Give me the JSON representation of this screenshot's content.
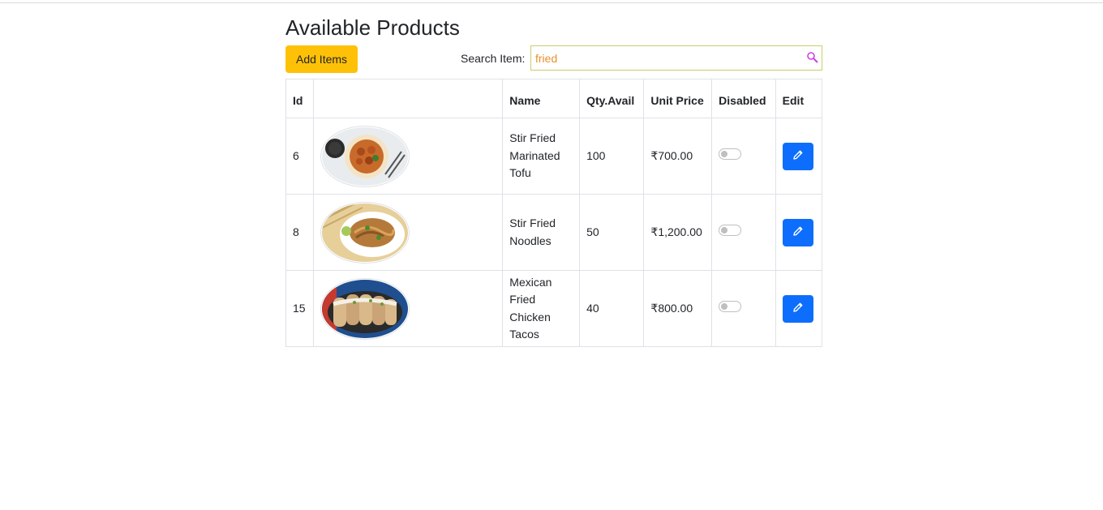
{
  "page": {
    "title": "Available Products"
  },
  "toolbar": {
    "add_label": "Add Items",
    "search_label": "Search Item:",
    "search_value": "fried"
  },
  "table": {
    "headers": {
      "id": "Id",
      "image": "",
      "name": "Name",
      "qty": "Qty.Avail",
      "price": "Unit Price",
      "disabled": "Disabled",
      "edit": "Edit"
    },
    "rows": [
      {
        "id": "6",
        "name": "Stir Fried Marinated Tofu",
        "qty": "100",
        "price": "₹700.00",
        "disabled": false,
        "image_icon": "tofu-bowl-image"
      },
      {
        "id": "8",
        "name": "Stir Fried Noodles",
        "qty": "50",
        "price": "₹1,200.00",
        "disabled": false,
        "image_icon": "noodles-plate-image"
      },
      {
        "id": "15",
        "name": "Mexican Fried Chicken Tacos",
        "qty": "40",
        "price": "₹800.00",
        "disabled": false,
        "image_icon": "tacos-plate-image"
      }
    ]
  },
  "colors": {
    "add_button": "#ffc107",
    "edit_button": "#0d6efd",
    "search_text": "#e8902b",
    "search_border": "#c9cf6a",
    "search_icon": "#cc44dd"
  }
}
